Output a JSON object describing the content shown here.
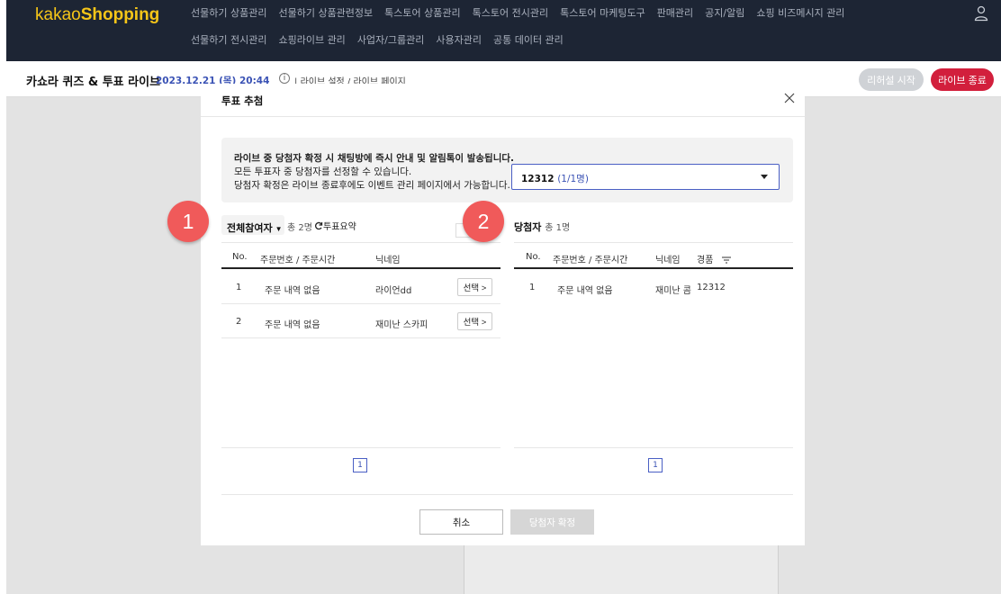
{
  "app": {
    "logo_prefix": "kakao",
    "logo_brand": "Shopping"
  },
  "nav": {
    "items": [
      "선물하기 상품관리",
      "선물하기 상품관련정보",
      "톡스토어 상품관리",
      "톡스토어 전시관리",
      "톡스토어 마케팅도구",
      "판매관리",
      "공지/알림",
      "쇼핑 비즈메시지 관리",
      "선물하기 전시관리",
      "쇼핑라이브 관리",
      "사업자/그룹관리",
      "사용자관리",
      "공통 데이터 관리"
    ]
  },
  "subheader": {
    "title": "카쇼라 퀴즈 & 투표 라이브",
    "date": "2023.12.21 (목) 20:44",
    "info": "i",
    "sep": "|",
    "link_settings": "라이브 설정",
    "slash": " / ",
    "link_page": "라이브 페이지",
    "rehearsal_label": "리허설 시작",
    "end_label": "라이브 종료"
  },
  "modal": {
    "title": "투표 추첨",
    "info_lines": [
      "라이브 중 당첨자 확정 시 채팅방에 즉시 안내 및 알림톡이 발송됩니다.",
      "모든 투표자 중 당첨자를 선정할 수 있습니다.",
      "당첨자 확정은 라이브 종료후에도 이벤트 관리 페이지에서 가능합니다."
    ],
    "select_value": "12312",
    "select_count": "(1/1명)",
    "left": {
      "filter_label": "전체참여자",
      "caret": "▼",
      "total": "총 2명",
      "vote_summary": "투표요약",
      "columns": [
        "No.",
        "주문번호 / 주문시간",
        "닉네임"
      ],
      "rows": [
        {
          "no": "1",
          "order": "주문 내역 없음",
          "nick": "라이언dd",
          "action": "선택 >"
        },
        {
          "no": "2",
          "order": "주문 내역 없음",
          "nick": "재미난 스카피",
          "action": "선택 >"
        }
      ],
      "page": "1"
    },
    "right": {
      "title": "당첨자",
      "total": "총 1명",
      "columns": [
        "No.",
        "주문번호 / 주문시간",
        "닉네임",
        "경품"
      ],
      "rows": [
        {
          "no": "1",
          "order": "주문 내역 없음",
          "nick": "재미난 콤",
          "prize": "12312"
        }
      ],
      "page": "1"
    },
    "cancel_label": "취소",
    "confirm_label": "당첨자 확정"
  },
  "markers": [
    "1",
    "2"
  ],
  "colors": {
    "nav_bg": "#1d2534",
    "logo": "#f5c518",
    "accent_blue": "#3b53b5",
    "live_red": "#d21f3c",
    "marker": "#f05a5a"
  }
}
